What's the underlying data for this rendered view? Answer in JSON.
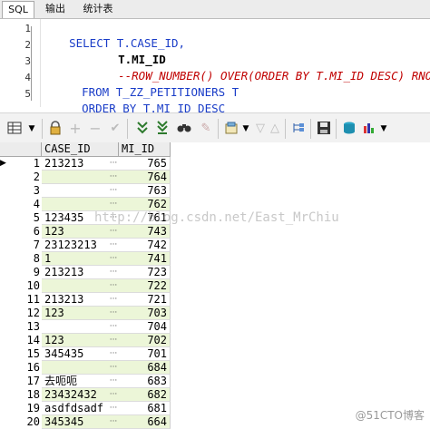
{
  "tabs": [
    "SQL",
    "输出",
    "统计表"
  ],
  "sql_lines": [
    {
      "num": "1",
      "text": "SELECT T.CASE_ID,"
    },
    {
      "num": "2",
      "text": "T.MI_ID"
    },
    {
      "num": "3",
      "text": "--ROW_NUMBER() OVER(ORDER BY T.MI_ID DESC) RNO"
    },
    {
      "num": "4",
      "text": "FROM T_ZZ_PETITIONERS T"
    },
    {
      "num": "5",
      "text": "ORDER BY T.MI_ID DESC"
    }
  ],
  "columns": {
    "case_id": "CASE_ID",
    "mi_id": "MI_ID"
  },
  "rows": [
    {
      "n": "1",
      "case_id": "213213",
      "mi_id": "765"
    },
    {
      "n": "2",
      "case_id": "",
      "mi_id": "764"
    },
    {
      "n": "3",
      "case_id": "",
      "mi_id": "763"
    },
    {
      "n": "4",
      "case_id": "",
      "mi_id": "762"
    },
    {
      "n": "5",
      "case_id": "123435",
      "mi_id": "761"
    },
    {
      "n": "6",
      "case_id": "123",
      "mi_id": "743"
    },
    {
      "n": "7",
      "case_id": "23123213",
      "mi_id": "742"
    },
    {
      "n": "8",
      "case_id": "1",
      "mi_id": "741"
    },
    {
      "n": "9",
      "case_id": "213213",
      "mi_id": "723"
    },
    {
      "n": "10",
      "case_id": "",
      "mi_id": "722"
    },
    {
      "n": "11",
      "case_id": "213213",
      "mi_id": "721"
    },
    {
      "n": "12",
      "case_id": "123",
      "mi_id": "703"
    },
    {
      "n": "13",
      "case_id": "",
      "mi_id": "704"
    },
    {
      "n": "14",
      "case_id": "123",
      "mi_id": "702"
    },
    {
      "n": "15",
      "case_id": "345435",
      "mi_id": "701"
    },
    {
      "n": "16",
      "case_id": "",
      "mi_id": "684"
    },
    {
      "n": "17",
      "case_id": "去呃呃",
      "mi_id": "683"
    },
    {
      "n": "18",
      "case_id": "23432432",
      "mi_id": "682"
    },
    {
      "n": "19",
      "case_id": "asdfdsadf",
      "mi_id": "681"
    },
    {
      "n": "20",
      "case_id": "345345",
      "mi_id": "664"
    }
  ],
  "dots": "···",
  "watermark": "http://blog.csdn.net/East_MrChiu",
  "corner_mark": "@51CTO博客",
  "colors": {
    "keyword": "#1a3dc8",
    "comment": "#c00000",
    "zebra": "#ecf6d8"
  }
}
